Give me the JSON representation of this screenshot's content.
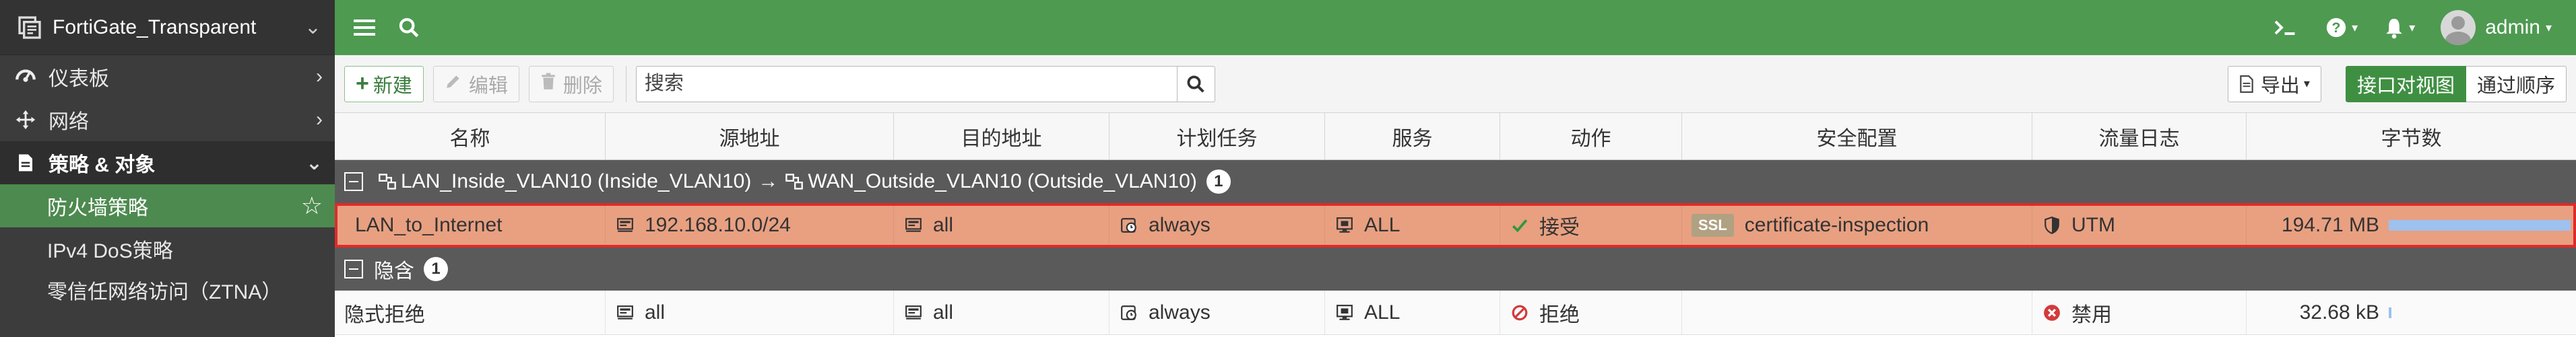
{
  "sidebar": {
    "device_name": "FortiGate_Transparent",
    "items": [
      {
        "label": "仪表板",
        "icon": "dashboard-icon"
      },
      {
        "label": "网络",
        "icon": "network-move-icon"
      },
      {
        "label": "策略 & 对象",
        "icon": "policy-document-icon",
        "expanded": true
      }
    ],
    "subitems": [
      {
        "label": "防火墙策略",
        "active": true
      },
      {
        "label": "IPv4 DoS策略"
      },
      {
        "label": "零信任网络访问（ZTNA）"
      }
    ]
  },
  "topbar": {
    "user": "admin",
    "icons": [
      "menu-icon",
      "search-icon",
      "cli-console-icon",
      "help-icon",
      "notification-bell-icon",
      "user-avatar-icon"
    ]
  },
  "toolbar": {
    "new_label": "新建",
    "edit_label": "编辑",
    "delete_label": "删除",
    "search_placeholder": "搜索",
    "export_label": "导出",
    "view_interface_pair": "接口对视图",
    "view_sequence": "通过顺序"
  },
  "table": {
    "columns": [
      "名称",
      "源地址",
      "目的地址",
      "计划任务",
      "服务",
      "动作",
      "安全配置",
      "流量日志",
      "字节数"
    ],
    "groups": [
      {
        "src_intf": "LAN_Inside_VLAN10 (Inside_VLAN10)",
        "arrow": "→",
        "dst_intf": "WAN_Outside_VLAN10 (Outside_VLAN10)",
        "count": "1",
        "rows": [
          {
            "name": "LAN_to_Internet",
            "source": "192.168.10.0/24",
            "destination": "all",
            "schedule": "always",
            "service": "ALL",
            "action": "接受",
            "security_tag": "SSL",
            "security": "certificate-inspection",
            "log": "UTM",
            "bytes": "194.71 MB",
            "bytes_fraction": 1.0,
            "selected": true
          }
        ]
      },
      {
        "label": "隐含",
        "count": "1",
        "rows": [
          {
            "name": "隐式拒绝",
            "source": "all",
            "destination": "all",
            "schedule": "always",
            "service": "ALL",
            "action": "拒绝",
            "security": "",
            "log": "禁用",
            "bytes": "32.68 kB",
            "bytes_fraction": 0.0002
          }
        ]
      }
    ]
  },
  "colors": {
    "topbar": "#4e9a51",
    "sidebar": "#3c3c3c",
    "active_nav": "#4d8a4f",
    "selected_row": "#e8a081",
    "selected_outline": "#e02a2a",
    "group_header": "#5a5a5a",
    "bytes_bar": "#9ec1ee",
    "accept_green": "#2e9a3a",
    "deny_red": "#d23b3b"
  }
}
